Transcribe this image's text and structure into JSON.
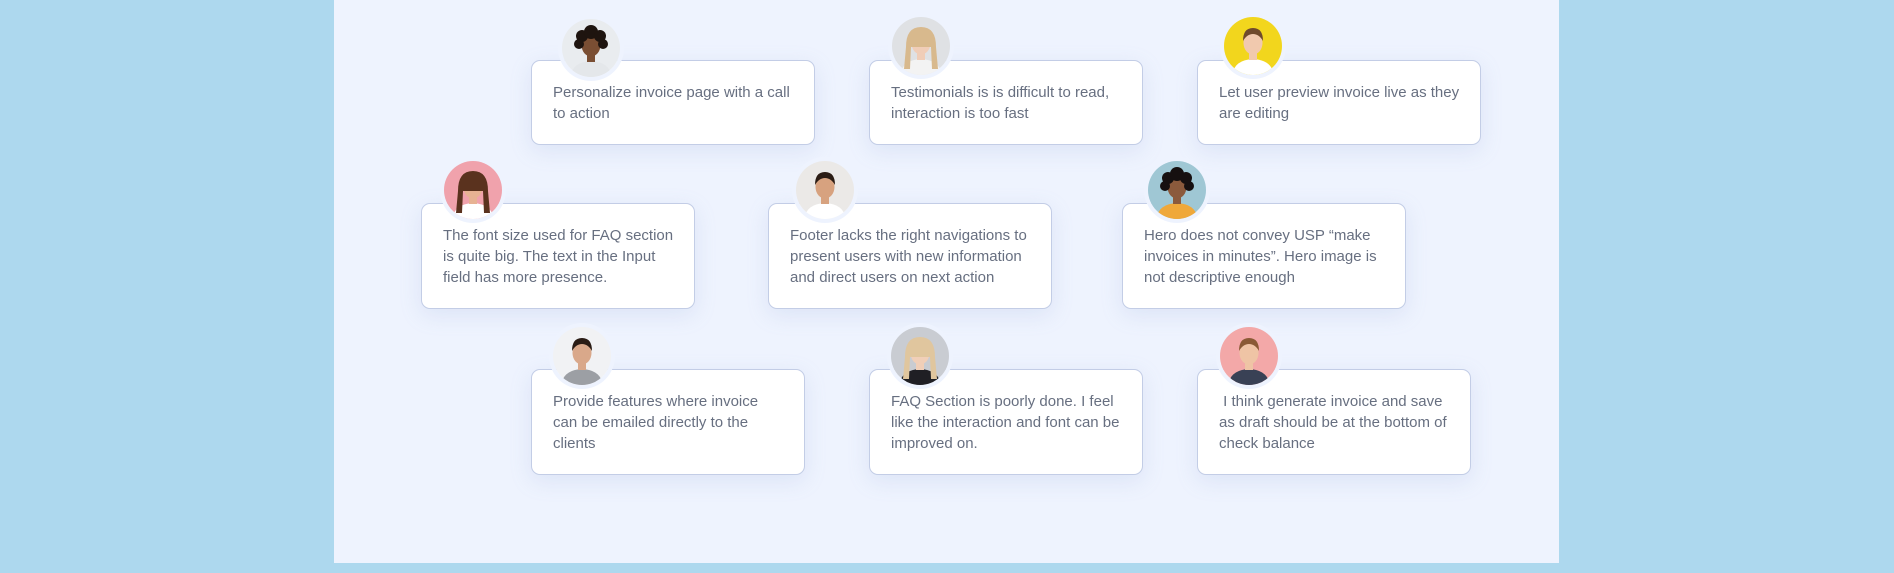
{
  "feedback": [
    {
      "text": "Personalize invoice page with a call to action",
      "avatar_bg": "#e9ecef",
      "skin": "#7a4e33",
      "hair": "#1e140f",
      "shirt": "#e4e7ea",
      "hair_style": "curly"
    },
    {
      "text": "Testimonials is is difficult to read, interaction is too fast",
      "avatar_bg": "#dfe1e4",
      "skin": "#f0cdb7",
      "hair": "#d8b98d",
      "shirt": "#f3f3f3",
      "hair_style": "long"
    },
    {
      "text": "Let user preview invoice live as they are editing",
      "avatar_bg": "#f2d61d",
      "skin": "#f1c9ae",
      "hair": "#6f4a2c",
      "shirt": "#ffffff",
      "hair_style": "short"
    },
    {
      "text": "The font size used for FAQ section is quite big. The text in the Input field has more presence.",
      "avatar_bg": "#f0a2ac",
      "skin": "#e7b293",
      "hair": "#5a321e",
      "shirt": "#ffffff",
      "hair_style": "long"
    },
    {
      "text": "Footer lacks the right navigations to present users with new information and direct users on next action",
      "avatar_bg": "#ebe9e7",
      "skin": "#d7a27f",
      "hair": "#2b1c14",
      "shirt": "#ffffff",
      "hair_style": "short"
    },
    {
      "text": "Hero does not convey USP “make invoices in minutes”. Hero image is not descriptive enough",
      "avatar_bg": "#9fc7d4",
      "skin": "#8b5a3c",
      "hair": "#161010",
      "shirt": "#efa83a",
      "hair_style": "curly"
    },
    {
      "text": "Provide features where invoice can be emailed directly to the clients",
      "avatar_bg": "#f1f2f4",
      "skin": "#d9a88a",
      "hair": "#2a1c15",
      "shirt": "#9c9fa4",
      "hair_style": "short"
    },
    {
      "text": "FAQ Section is poorly done. I feel like the interaction and font can be improved on.",
      "avatar_bg": "#c9ccd2",
      "skin": "#f1cfb8",
      "hair": "#e0c69e",
      "shirt": "#1f1f24",
      "hair_style": "long"
    },
    {
      "text": " I think generate invoice and save as draft should be at the bottom of check balance",
      "avatar_bg": "#f3a8a8",
      "skin": "#efc4a5",
      "hair": "#8a5a35",
      "shirt": "#394155",
      "hair_style": "short"
    }
  ]
}
